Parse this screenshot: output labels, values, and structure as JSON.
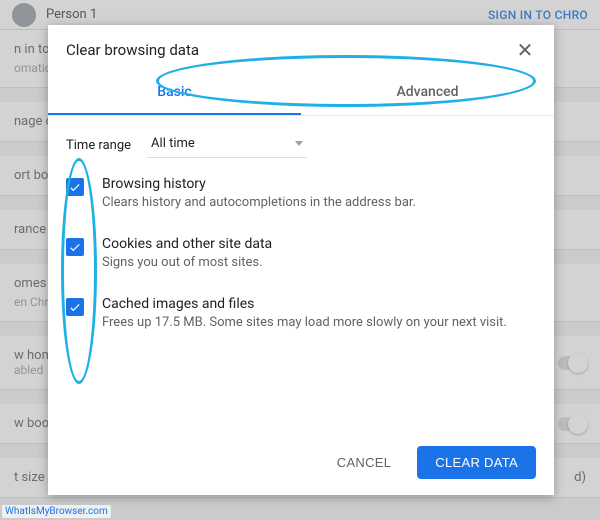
{
  "bg": {
    "person": "Person 1",
    "signin": "SIGN IN TO CHRO",
    "row1": "n in to g",
    "row1b": "omatica",
    "row2": "nage ot",
    "row3": "ort boo",
    "row4": "rance",
    "row5": "omes",
    "row5b": "en Chro",
    "row6": "w home",
    "row6b": "abled",
    "row7": "w book",
    "row8": "t size",
    "row8b": "d)"
  },
  "dialog": {
    "title": "Clear browsing data",
    "tabs": {
      "basic": "Basic",
      "advanced": "Advanced"
    },
    "time": {
      "label": "Time range",
      "value": "All time"
    },
    "options": [
      {
        "label": "Browsing history",
        "desc": "Clears history and autocompletions in the address bar."
      },
      {
        "label": "Cookies and other site data",
        "desc": "Signs you out of most sites."
      },
      {
        "label": "Cached images and files",
        "desc": "Frees up 17.5 MB. Some sites may load more slowly on your next visit."
      }
    ],
    "cancel": "CANCEL",
    "confirm": "CLEAR DATA"
  },
  "watermark": "WhatIsMyBrowser.com"
}
